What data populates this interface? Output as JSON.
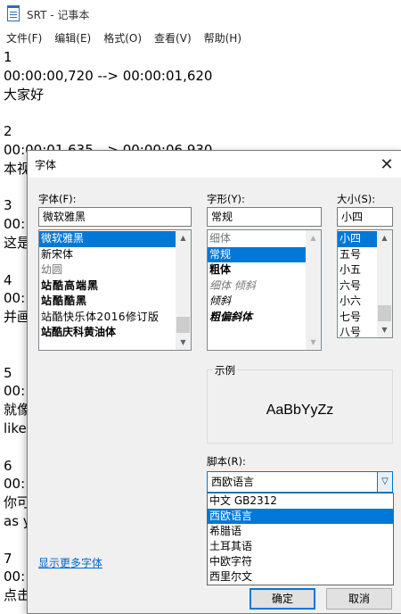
{
  "notepad": {
    "title": "SRT - 记事本",
    "menu": [
      "文件(F)",
      "编辑(E)",
      "格式(O)",
      "查看(V)",
      "帮助(H)"
    ],
    "lines": [
      "1",
      "00:00:00,720 --> 00:00:01,620",
      "大家好",
      "",
      "2",
      "00:00:01,635 --> 00:00:06,930",
      "本视",
      "",
      "3",
      "00:",
      "这是",
      "",
      "4",
      "00:",
      "并画",
      "",
      "",
      "5",
      "00:",
      "就像",
      "like",
      "",
      "6",
      "00:",
      "你可",
      "as y",
      "",
      "7",
      "00:",
      "点击"
    ]
  },
  "dialog": {
    "title": "字体",
    "close_icon": "close-icon",
    "font": {
      "label": "字体(F):",
      "value": "微软雅黑",
      "items": [
        "微软雅黑",
        "新宋体",
        "幼圆",
        "站酷高端黑",
        "站酷酷黑",
        "站酷快乐体2016修订版",
        "站酷庆科黄油体"
      ],
      "selected": 0
    },
    "style": {
      "label": "字形(Y):",
      "value": "常规",
      "items": [
        "细体",
        "常规",
        "粗体",
        "细体 倾斜",
        "倾斜",
        "粗偏斜体"
      ],
      "selected": 1
    },
    "size": {
      "label": "大小(S):",
      "value": "小四",
      "items": [
        "小四",
        "五号",
        "小五",
        "六号",
        "小六",
        "七号",
        "八号"
      ],
      "selected": 0
    },
    "sample": {
      "label": "示例",
      "text": "AaBbYyZz"
    },
    "script": {
      "label": "脚本(R):",
      "value": "西欧语言",
      "options": [
        "中文 GB2312",
        "西欧语言",
        "希腊语",
        "土耳其语",
        "中欧字符",
        "西里尔文"
      ],
      "selected": 1
    },
    "more_fonts_link": "显示更多字体",
    "ok_label": "确定",
    "cancel_label": "取消"
  },
  "colors": {
    "selection": "#0078d7",
    "link": "#0066cc",
    "dialog_bg": "#f0f0f0"
  }
}
